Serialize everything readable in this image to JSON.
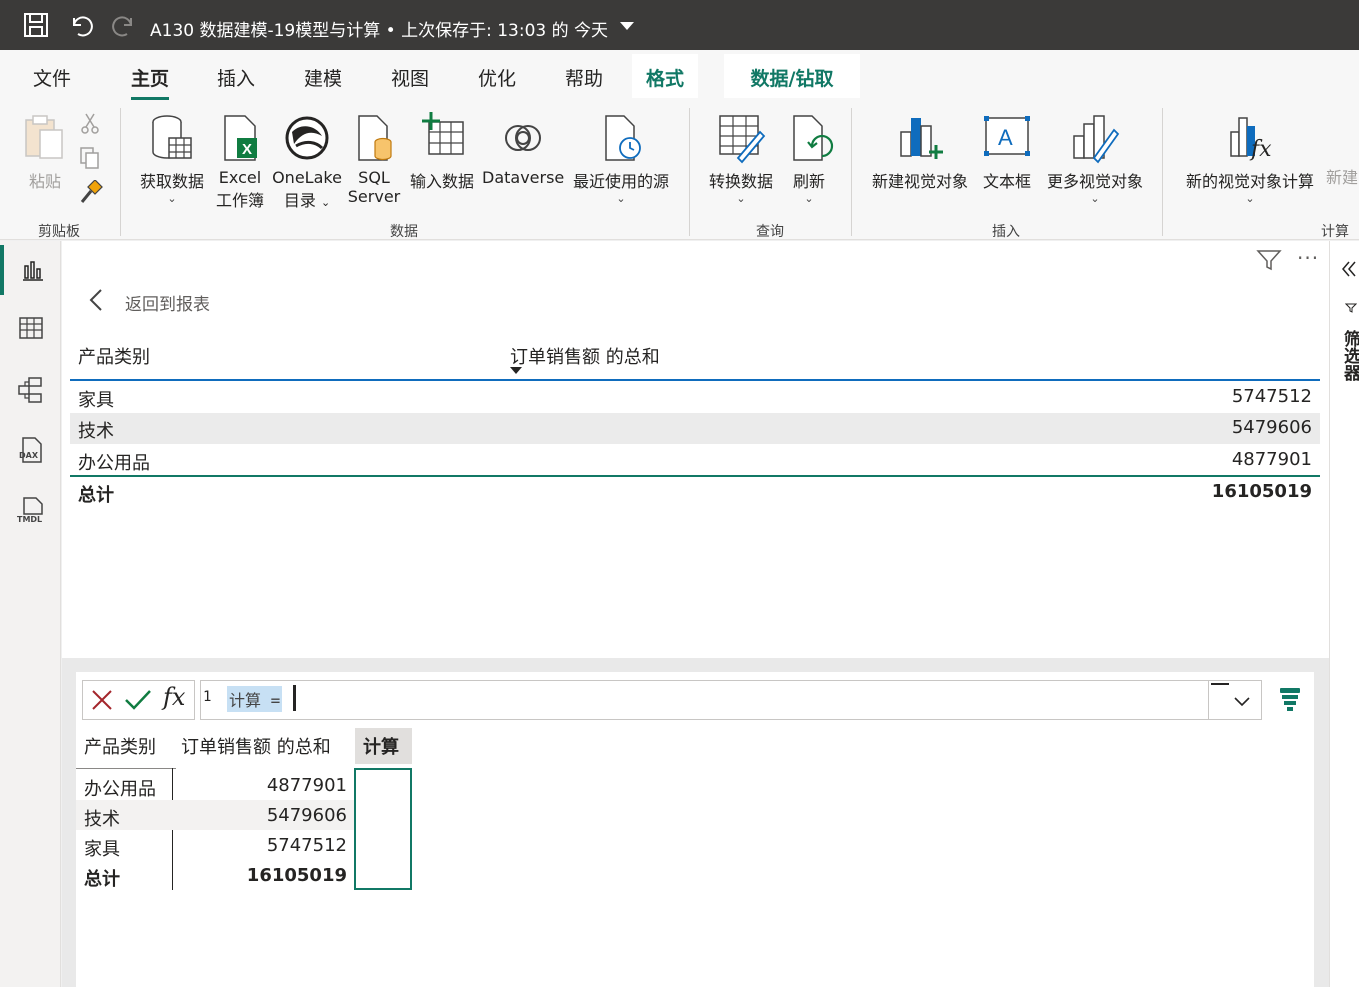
{
  "titlebar": {
    "title": "A130 数据建模-19模型与计算 • 上次保存于: 13:03 的 今天"
  },
  "tabs": {
    "file": "文件",
    "home": "主页",
    "insert": "插入",
    "modeling": "建模",
    "view": "视图",
    "optimize": "优化",
    "help": "帮助",
    "format": "格式",
    "data_drill": "数据/钻取"
  },
  "ribbon": {
    "clipboard": {
      "paste": "粘贴",
      "group": "剪贴板"
    },
    "data": {
      "get_data": "获取数据",
      "excel_line1": "Excel",
      "excel_line2": "工作簿",
      "onelake_line1": "OneLake",
      "onelake_line2": "目录",
      "sql_line1": "SQL",
      "sql_line2": "Server",
      "enter_data": "输入数据",
      "dataverse": "Dataverse",
      "recent_sources": "最近使用的源",
      "group": "数据"
    },
    "query": {
      "transform": "转换数据",
      "refresh": "刷新",
      "group": "查询"
    },
    "insert": {
      "new_visual": "新建视觉对象",
      "text_box": "文本框",
      "more_visuals": "更多视觉对象",
      "group": "插入"
    },
    "calc": {
      "new_visual_calc": "新的视觉对象计算",
      "new_partial": "新建",
      "group": "计算"
    }
  },
  "canvas": {
    "back_label": "返回到报表",
    "filters_label": "筛选器",
    "table": {
      "col1": "产品类别",
      "col2": "订单销售额 的总和",
      "rows": [
        {
          "category": "家具",
          "value": "5747512"
        },
        {
          "category": "技术",
          "value": "5479606"
        },
        {
          "category": "办公用品",
          "value": "4877901"
        }
      ],
      "total_label": "总计",
      "total_value": "16105019"
    }
  },
  "formula": {
    "line_number": "1",
    "text": "计算 ="
  },
  "data_grid": {
    "col1": "产品类别",
    "col2": "订单销售额 的总和",
    "col3": "计算",
    "rows": [
      {
        "category": "办公用品",
        "value": "4877901"
      },
      {
        "category": "技术",
        "value": "5479606"
      },
      {
        "category": "家具",
        "value": "5747512"
      }
    ],
    "total_label": "总计",
    "total_value": "16105019"
  },
  "colors": {
    "accent": "#117865",
    "titlebar": "#3b3a39",
    "highlight": "#c7e0f4",
    "cancel_red": "#a4262c"
  }
}
